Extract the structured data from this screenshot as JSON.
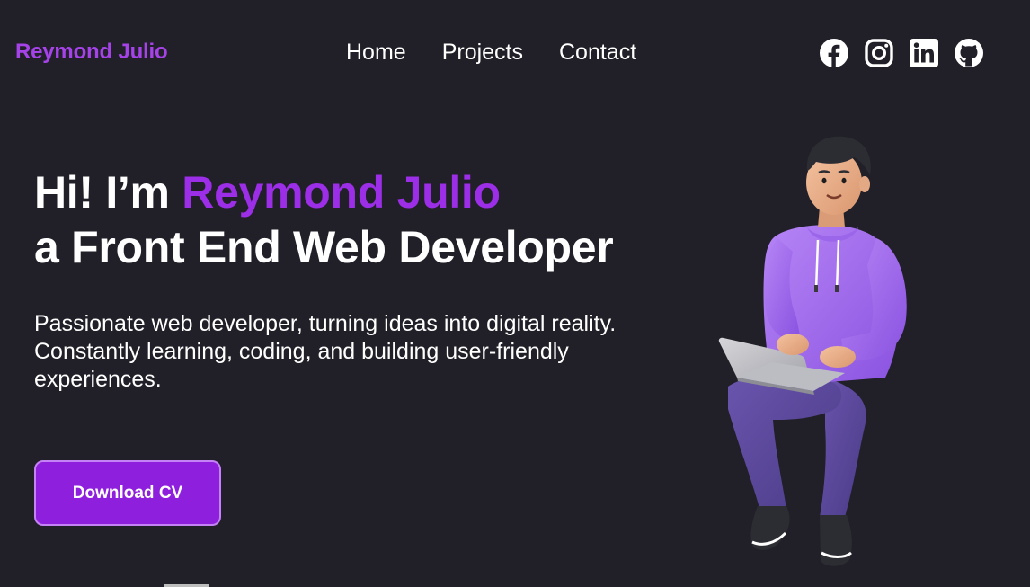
{
  "nav": {
    "logo": "Reymond Julio",
    "links": [
      {
        "label": "Home"
      },
      {
        "label": "Projects"
      },
      {
        "label": "Contact"
      }
    ],
    "socials": [
      {
        "icon": "facebook-icon"
      },
      {
        "icon": "instagram-icon"
      },
      {
        "icon": "linkedin-icon"
      },
      {
        "icon": "github-icon"
      }
    ]
  },
  "hero": {
    "greeting": "Hi! I’m ",
    "name": "Reymond Julio",
    "role": "a Front End Web Developer",
    "description": "Passionate web developer, turning ideas into digital reality. Constantly learning, coding, and building user-friendly experiences.",
    "cta_label": "Download CV"
  },
  "illustration": {
    "icon": "developer-3d-avatar-icon"
  },
  "colors": {
    "background": "#212028",
    "accent": "#9b2ee6",
    "logo": "#a542e8",
    "button": "#8e20dd",
    "button_border": "#c482f4",
    "hoodie": "#a26af0",
    "pants": "#5b4598"
  }
}
